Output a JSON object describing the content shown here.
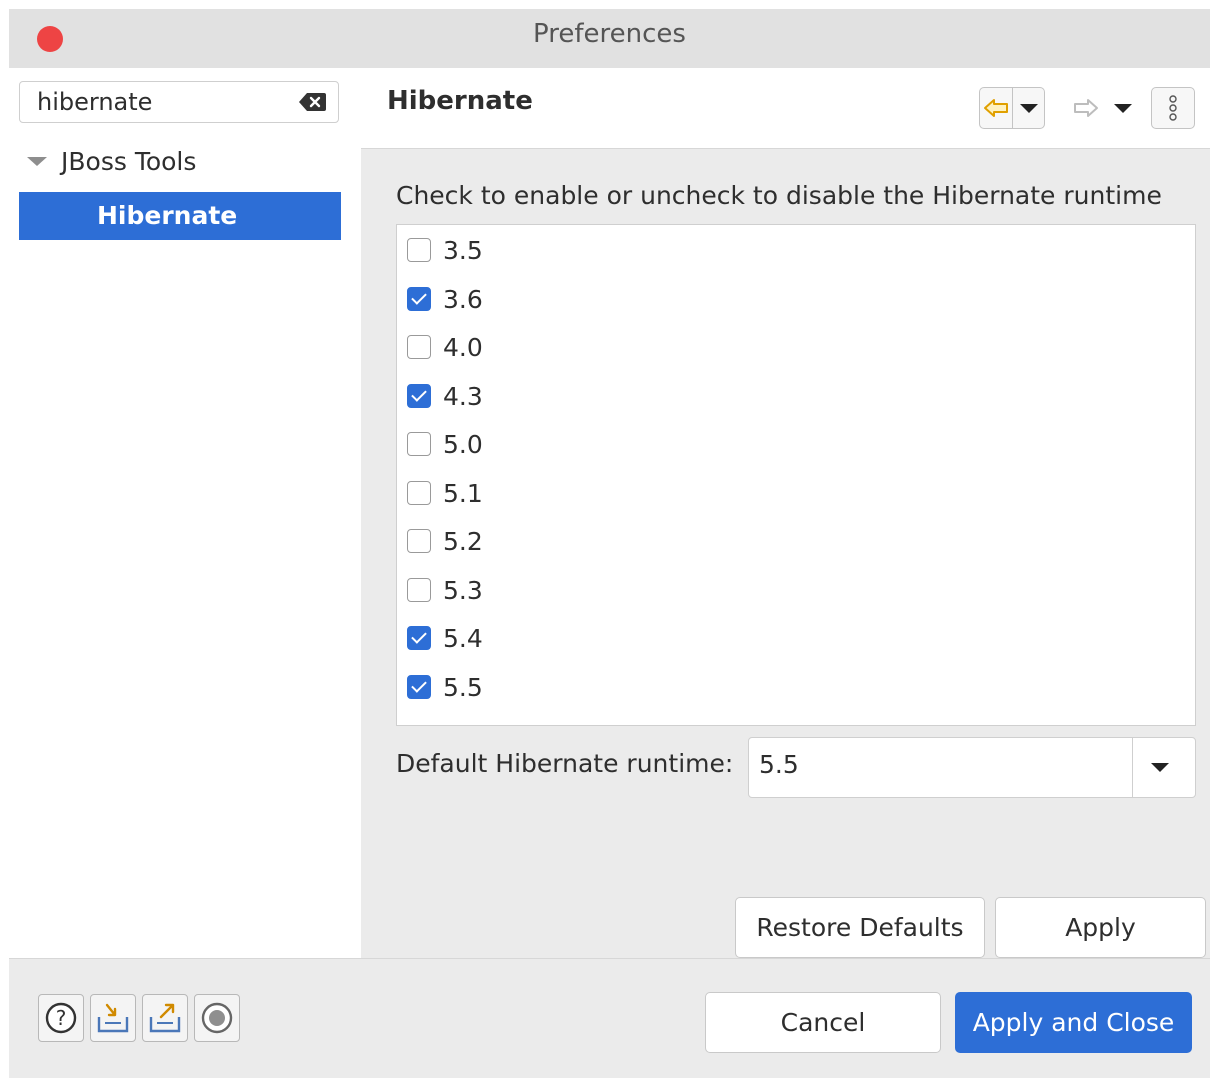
{
  "window": {
    "title": "Preferences"
  },
  "sidebar": {
    "filter_value": "hibernate",
    "tree": {
      "parent_label": "JBoss Tools",
      "child_label": "Hibernate"
    }
  },
  "page": {
    "title": "Hibernate",
    "description": "Check to enable or uncheck to disable the Hibernate runtime",
    "runtimes": [
      {
        "label": "3.5",
        "checked": false
      },
      {
        "label": "3.6",
        "checked": true
      },
      {
        "label": "4.0",
        "checked": false
      },
      {
        "label": "4.3",
        "checked": true
      },
      {
        "label": "5.0",
        "checked": false
      },
      {
        "label": "5.1",
        "checked": false
      },
      {
        "label": "5.2",
        "checked": false
      },
      {
        "label": "5.3",
        "checked": false
      },
      {
        "label": "5.4",
        "checked": true
      },
      {
        "label": "5.5",
        "checked": true
      }
    ],
    "default_runtime_label": "Default Hibernate runtime:",
    "default_runtime_value": "5.5",
    "restore_defaults_label": "Restore Defaults",
    "apply_label": "Apply"
  },
  "footer": {
    "cancel_label": "Cancel",
    "apply_close_label": "Apply and Close"
  },
  "icons": {
    "close": "close-dot",
    "clear": "clear-text-icon",
    "back": "back-arrow-icon",
    "forward": "forward-arrow-icon",
    "more": "view-menu-icon",
    "help": "help-icon",
    "import": "import-icon",
    "export": "export-icon",
    "record": "record-icon"
  },
  "colors": {
    "accent": "#2d6ed6",
    "close": "#ee4444",
    "back_arrow": "#e0a000"
  }
}
